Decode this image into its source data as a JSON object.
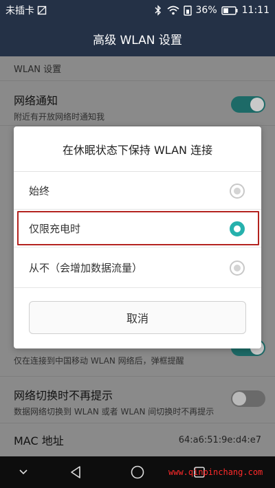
{
  "status_bar": {
    "carrier": "未插卡",
    "battery_percent": "36%",
    "time": "11:11"
  },
  "action_bar": {
    "title": "高级 WLAN 设置"
  },
  "settings": {
    "section_header": "WLAN 设置",
    "network_notify": {
      "title": "网络通知",
      "subtitle": "附近有开放网络时通知我",
      "enabled": true
    },
    "cmcc_popup": {
      "subtitle": "仅在连接到中国移动 WLAN 网络后，弹框提醒",
      "enabled": true
    },
    "no_switch_prompt": {
      "title": "网络切换时不再提示",
      "subtitle": "数据网络切换到 WLAN 或者 WLAN 间切换时不再提示",
      "enabled": false
    },
    "mac": {
      "label": "MAC 地址",
      "value": "64:a6:51:9e:d4:e7"
    }
  },
  "dialog": {
    "title": "在休眠状态下保持 WLAN 连接",
    "options": [
      {
        "label": "始终",
        "selected": false
      },
      {
        "label": "仅限充电时",
        "selected": true
      },
      {
        "label": "从不（会增加数据流量）",
        "selected": false
      }
    ],
    "cancel_label": "取消"
  },
  "watermark": "www.qinpinchang.com",
  "colors": {
    "status_bar": "#243146",
    "accent": "#26b1ad",
    "highlight": "#b3221e"
  },
  "icons": [
    "no-sim-icon",
    "bluetooth-off-icon",
    "wifi-icon",
    "sim-battery-icon",
    "battery-icon",
    "back-icon",
    "home-icon",
    "recents-icon",
    "nav-collapse-icon"
  ]
}
